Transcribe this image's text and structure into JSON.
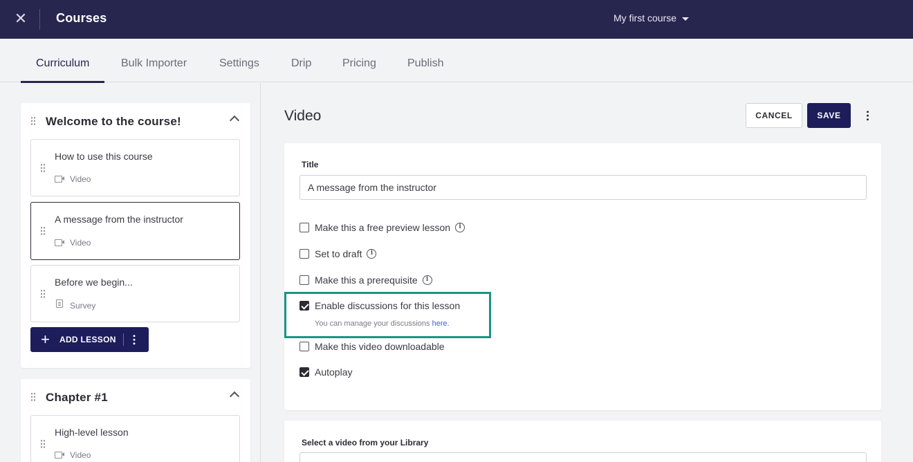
{
  "topbar": {
    "close_glyph": "✕",
    "title": "Courses",
    "course_selector": "My first course"
  },
  "tabs": [
    "Curriculum",
    "Bulk Importer",
    "Settings",
    "Drip",
    "Pricing",
    "Publish"
  ],
  "sidebar": {
    "chapters": [
      {
        "title": "Welcome to the course!",
        "lessons": [
          {
            "name": "How to use this course",
            "type": "Video"
          },
          {
            "name": "A message from the instructor",
            "type": "Video"
          },
          {
            "name": "Before we begin...",
            "type": "Survey"
          }
        ],
        "add_lesson_label": "ADD LESSON"
      },
      {
        "title": "Chapter #1",
        "lessons": [
          {
            "name": "High-level lesson",
            "type": "Video"
          }
        ]
      }
    ]
  },
  "main": {
    "title": "Video",
    "cancel_label": "CANCEL",
    "save_label": "SAVE",
    "form": {
      "title_label": "Title",
      "title_value": "A message from the instructor",
      "options": [
        {
          "label": "Make this a free preview lesson",
          "checked": false,
          "info": true
        },
        {
          "label": "Set to draft",
          "checked": false,
          "info": true
        },
        {
          "label": "Make this a prerequisite",
          "checked": false,
          "info": true
        },
        {
          "label": "Enable discussions for this lesson",
          "checked": true,
          "info": false
        },
        {
          "label": "Make this video downloadable",
          "checked": false,
          "info": false
        },
        {
          "label": "Autoplay",
          "checked": true,
          "info": false
        }
      ],
      "discussion_helper": "You can manage your discussions ",
      "discussion_helper_link": "here."
    },
    "library": {
      "label": "Select a video from your Library"
    }
  },
  "colors": {
    "navy": "#26264f",
    "button": "#1d1d5c",
    "highlight": "#199580",
    "link": "#3e5fc4"
  }
}
